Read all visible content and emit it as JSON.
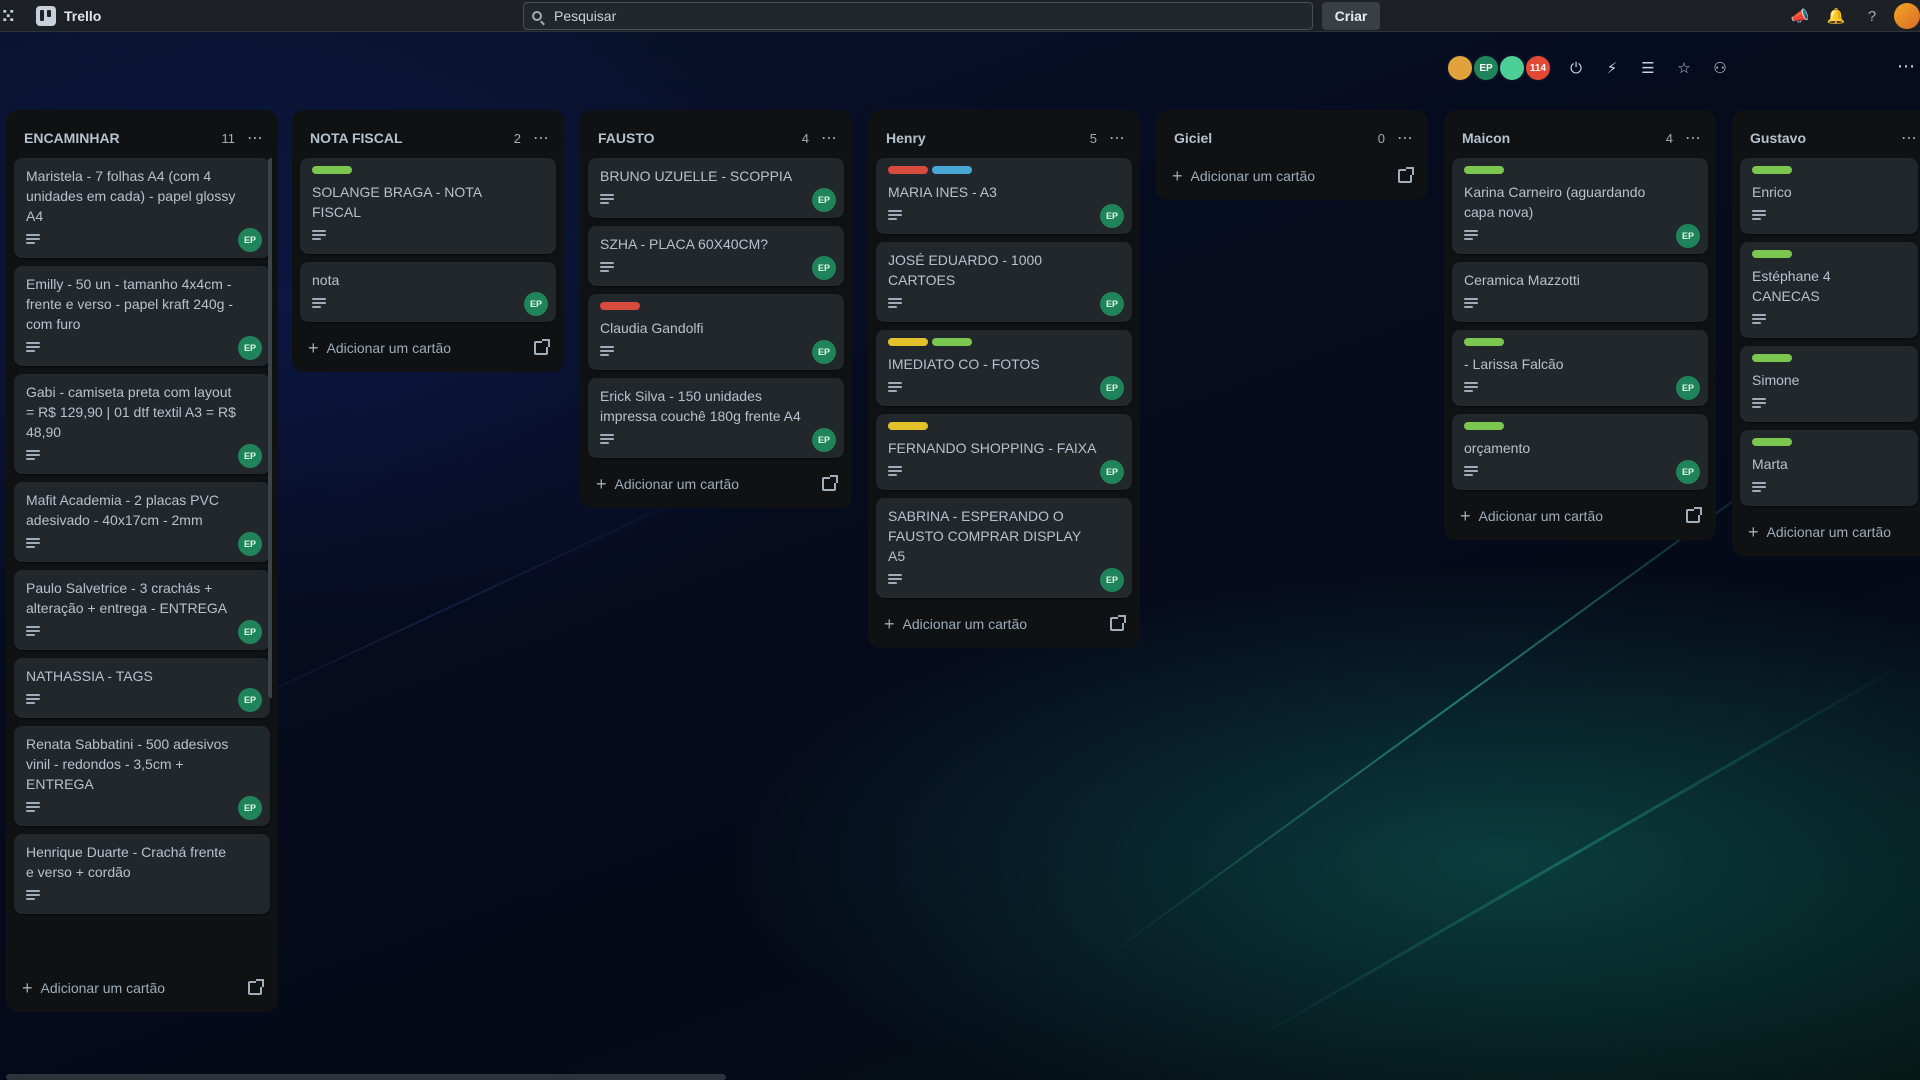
{
  "topbar": {
    "apps_glyph": "ⵘ",
    "brand": "Trello",
    "search_placeholder": "Pesquisar",
    "create_label": "Criar"
  },
  "board": {
    "members": [
      {
        "initials": "",
        "color": "#e2a23b"
      },
      {
        "initials": "EP",
        "color": "#1f845a"
      },
      {
        "initials": "",
        "color": "#4bce97"
      },
      {
        "initials": "114",
        "color": "#e34935"
      }
    ]
  },
  "colors": {
    "green": "#7ac74f",
    "red": "#d94b3f",
    "blue": "#4aa8d8",
    "yellow": "#e2c12b",
    "badge": "#1f845a"
  },
  "lists": [
    {
      "title": "ENCAMINHAR",
      "count": "11",
      "add_label": "Adicionar um cartão",
      "cards": [
        {
          "title": "Maristela - 7 folhas A4 (com 4 unidades em cada) - papel glossy A4",
          "badge": "EP",
          "labels": []
        },
        {
          "title": "Emilly - 50 un - tamanho 4x4cm - frente e verso - papel kraft 240g - com furo",
          "badge": "EP",
          "labels": []
        },
        {
          "title": "Gabi - camiseta preta com layout = R$ 129,90 | 01 dtf textil A3 = R$ 48,90",
          "badge": "EP",
          "labels": []
        },
        {
          "title": "Mafit Academia - 2 placas PVC adesivado - 40x17cm - 2mm",
          "badge": "EP",
          "labels": []
        },
        {
          "title": "Paulo Salvetrice - 3 crachás + alteração + entrega - ENTREGA",
          "badge": "EP",
          "labels": []
        },
        {
          "title": "NATHASSIA - TAGS",
          "badge": "EP",
          "labels": []
        },
        {
          "title": "Renata Sabbatini - 500 adesivos vinil - redondos - 3,5cm + ENTREGA",
          "badge": "EP",
          "labels": []
        },
        {
          "title": "Henrique Duarte - Crachá frente e verso + cordão",
          "badge": "",
          "labels": []
        }
      ]
    },
    {
      "title": "NOTA FISCAL",
      "count": "2",
      "add_label": "Adicionar um cartão",
      "cards": [
        {
          "title": "SOLANGE BRAGA - NOTA FISCAL",
          "badge": "",
          "labels": [
            "green"
          ]
        },
        {
          "title": "nota",
          "badge": "EP",
          "labels": []
        }
      ]
    },
    {
      "title": "FAUSTO",
      "count": "4",
      "add_label": "Adicionar um cartão",
      "cards": [
        {
          "title": "BRUNO UZUELLE - SCOPPIA",
          "badge": "EP",
          "labels": []
        },
        {
          "title": "SZHA - PLACA 60X40CM?",
          "badge": "EP",
          "labels": []
        },
        {
          "title": "Claudia Gandolfi",
          "badge": "EP",
          "labels": [
            "red"
          ]
        },
        {
          "title": "Erick Silva - 150 unidades impressa couchê 180g frente A4",
          "badge": "EP",
          "labels": []
        }
      ]
    },
    {
      "title": "Henry",
      "count": "5",
      "add_label": "Adicionar um cartão",
      "cards": [
        {
          "title": "MARIA INES - A3",
          "badge": "EP",
          "labels": [
            "red",
            "blue"
          ]
        },
        {
          "title": "JOSÉ EDUARDO - 1000 CARTOES",
          "badge": "EP",
          "labels": []
        },
        {
          "title": "IMEDIATO CO - FOTOS",
          "badge": "EP",
          "labels": [
            "yellow",
            "green"
          ]
        },
        {
          "title": "FERNANDO SHOPPING - FAIXA",
          "badge": "EP",
          "labels": [
            "yellow"
          ]
        },
        {
          "title": "SABRINA - ESPERANDO O FAUSTO COMPRAR DISPLAY A5",
          "badge": "EP",
          "labels": []
        }
      ]
    },
    {
      "title": "Giciel",
      "count": "0",
      "add_label": "Adicionar um cartão",
      "cards": []
    },
    {
      "title": "Maicon",
      "count": "4",
      "add_label": "Adicionar um cartão",
      "cards": [
        {
          "title": "Karina Carneiro (aguardando capa nova)",
          "badge": "EP",
          "labels": [
            "green"
          ]
        },
        {
          "title": "Ceramica Mazzotti",
          "badge": "",
          "labels": []
        },
        {
          "title": "- Larissa Falcão",
          "badge": "EP",
          "labels": [
            "green"
          ]
        },
        {
          "title": "orçamento",
          "badge": "EP",
          "labels": [
            "green"
          ]
        }
      ]
    },
    {
      "title": "Gustavo",
      "count": "",
      "add_label": "Adicionar um cartão",
      "cards": [
        {
          "title": "Enrico",
          "badge": "",
          "labels": [
            "green"
          ]
        },
        {
          "title": "Estéphane 4 CANECAS",
          "badge": "",
          "labels": [
            "green"
          ]
        },
        {
          "title": "Simone",
          "badge": "",
          "labels": [
            "green"
          ]
        },
        {
          "title": "Marta",
          "badge": "",
          "labels": [
            "green"
          ]
        }
      ]
    }
  ]
}
